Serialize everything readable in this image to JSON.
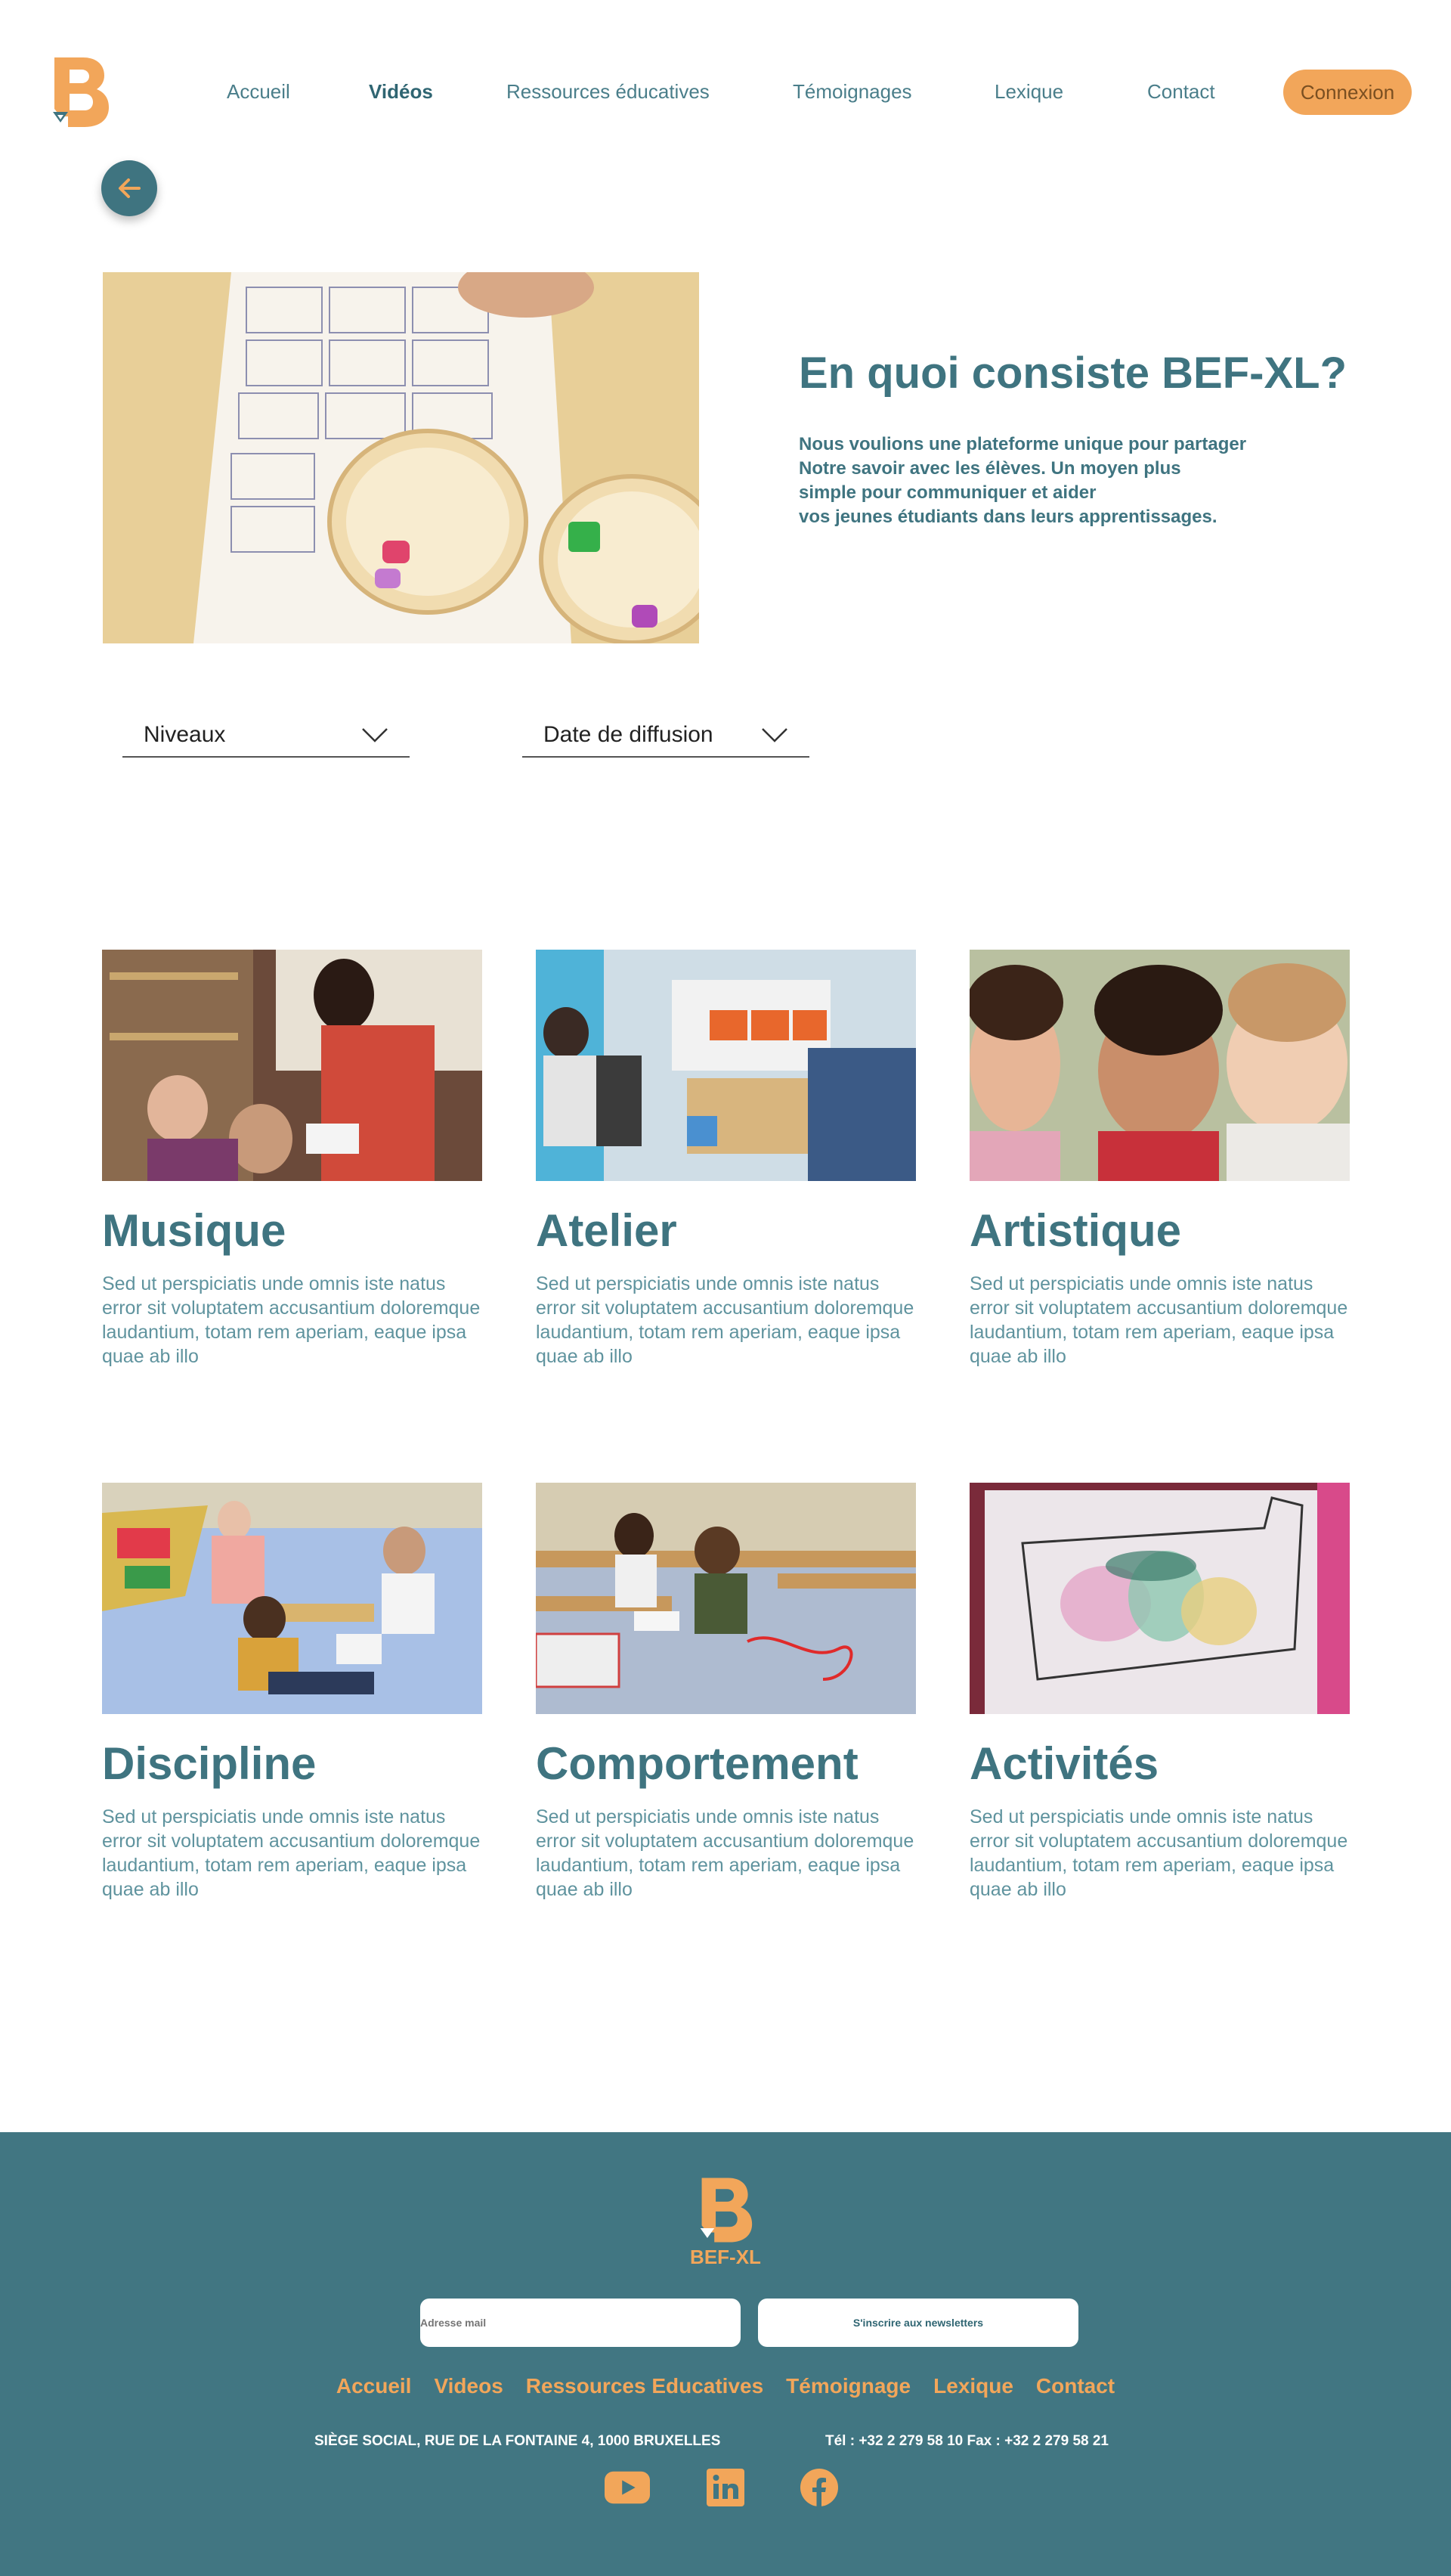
{
  "brand": {
    "name": "BEF-XL",
    "logo_letter": "B",
    "color_primary": "#3f7480",
    "color_accent": "#f2a65a"
  },
  "nav": {
    "items": [
      {
        "label": "Accueil",
        "active": false
      },
      {
        "label": "Vidéos",
        "active": true
      },
      {
        "label": "Ressources éducatives",
        "active": false
      },
      {
        "label": "Témoignages",
        "active": false
      },
      {
        "label": "Lexique",
        "active": false
      },
      {
        "label": "Contact",
        "active": false
      }
    ],
    "login_label": "Connexion"
  },
  "back_button": {
    "icon": "arrow-left-icon"
  },
  "hero": {
    "title": "En quoi consiste BEF-XL?",
    "text": "Nous voulions une plateforme unique pour partager\nNotre savoir avec les élèves. Un moyen plus\nsimple pour communiquer et aider\nvos jeunes étudiants dans leurs apprentissages."
  },
  "filters": [
    {
      "label": "Niveaux",
      "icon": "chevron-down-icon"
    },
    {
      "label": "Date de diffusion",
      "icon": "chevron-down-icon"
    }
  ],
  "cards": [
    {
      "title": "Musique",
      "description": "Sed ut perspiciatis unde omnis iste natus error sit voluptatem accusantium doloremque laudantium, totam rem aperiam, eaque ipsa quae ab illo"
    },
    {
      "title": "Atelier",
      "description": "Sed ut perspiciatis unde omnis iste natus error sit voluptatem accusantium doloremque laudantium, totam rem aperiam, eaque ipsa quae ab illo"
    },
    {
      "title": "Artistique",
      "description": "Sed ut perspiciatis unde omnis iste natus error sit voluptatem accusantium doloremque laudantium, totam rem aperiam, eaque ipsa quae ab illo"
    },
    {
      "title": "Discipline",
      "description": "Sed ut perspiciatis unde omnis iste natus error sit voluptatem accusantium doloremque laudantium, totam rem aperiam, eaque ipsa quae ab illo"
    },
    {
      "title": "Comportement",
      "description": "Sed ut perspiciatis unde omnis iste natus error sit voluptatem accusantium doloremque laudantium, totam rem aperiam, eaque ipsa quae ab illo"
    },
    {
      "title": "Activités",
      "description": "Sed ut perspiciatis unde omnis iste natus error sit voluptatem accusantium doloremque laudantium, totam rem aperiam, eaque ipsa quae ab illo"
    }
  ],
  "footer": {
    "brand_label": "BEF-XL",
    "email_placeholder": "Adresse mail",
    "newsletter_label": "S'inscrire aux newsletters",
    "links": [
      "Accueil",
      "Videos",
      "Ressources Educatives",
      "Témoignage",
      "Lexique",
      "Contact"
    ],
    "address": "SIÈGE SOCIAL, RUE DE LA FONTAINE 4, 1000 BRUXELLES",
    "phone": "Tél : +32 2 279 58 10 Fax : +32 2 279 58 21",
    "social": [
      "youtube-icon",
      "linkedin-icon",
      "facebook-icon"
    ]
  }
}
